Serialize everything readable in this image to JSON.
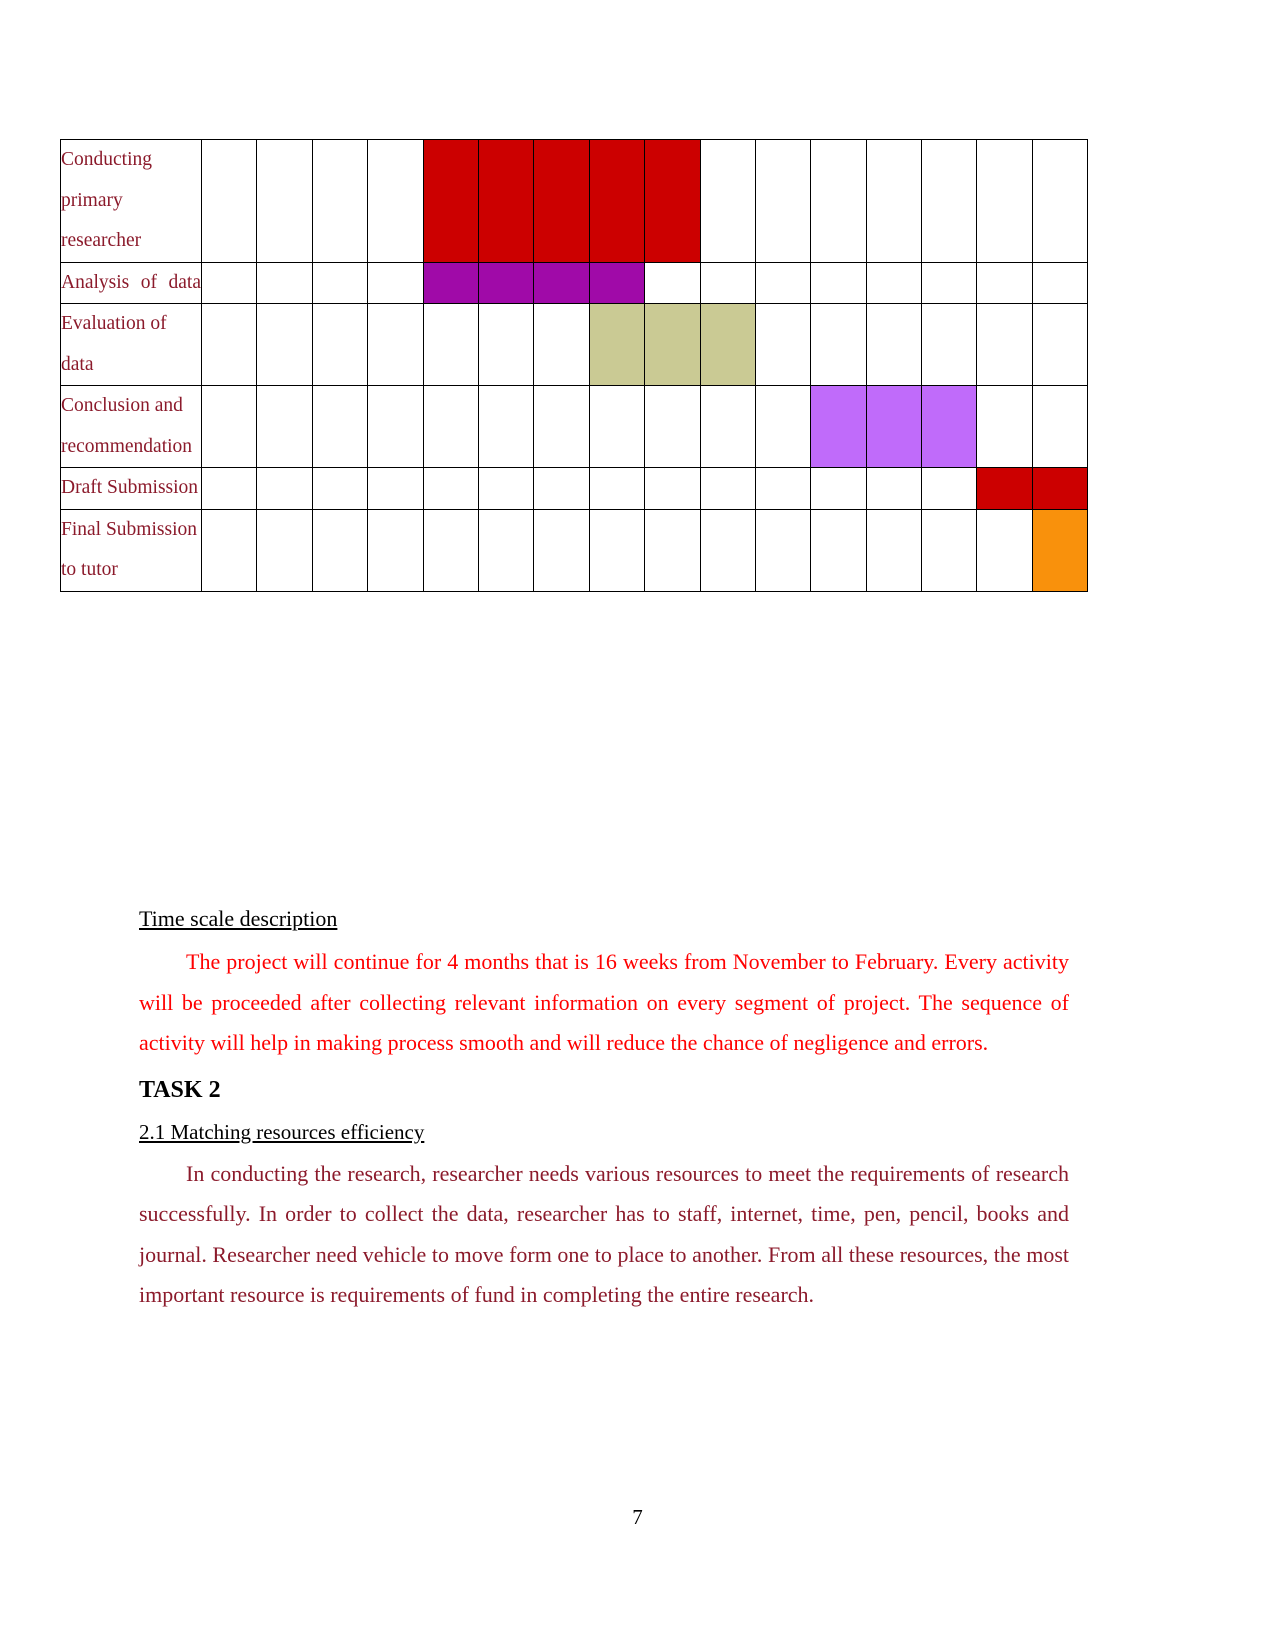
{
  "document": {
    "page_number": "7"
  },
  "gantt": {
    "columns": 16,
    "colors": {
      "red": "#CC0000",
      "purple": "#A00AA8",
      "khaki": "#CACA94",
      "orchid": "#C06BFA",
      "orange": "#F9910C"
    },
    "rows": [
      {
        "task": "Conducting primary researcher",
        "bar_start": 5,
        "bar_end": 9,
        "color_key": "red",
        "justify": false
      },
      {
        "task": "Analysis of data",
        "bar_start": 5,
        "bar_end": 8,
        "color_key": "purple",
        "justify": true
      },
      {
        "task": "Evaluation of data",
        "bar_start": 8,
        "bar_end": 10,
        "color_key": "khaki",
        "justify": false
      },
      {
        "task": "Conclusion and recommendation",
        "bar_start": 12,
        "bar_end": 14,
        "color_key": "orchid",
        "justify": false
      },
      {
        "task": "Draft Submission",
        "bar_start": 15,
        "bar_end": 16,
        "color_key": "red",
        "justify": false
      },
      {
        "task": "Final Submission to tutor",
        "bar_start": 16,
        "bar_end": 16,
        "color_key": "orange",
        "justify": false
      }
    ]
  },
  "sections": {
    "timescale_heading": "Time scale description",
    "timescale_paragraph": "The project will continue for 4 months that is 16 weeks from November to February. Every activity will be proceeded after collecting relevant information on every segment of project. The sequence of activity will help in making process smooth and will reduce the chance of negligence and errors.",
    "task_heading": "TASK 2",
    "subsection_heading": "2.1 Matching resources efficiency",
    "subsection_paragraph": "In conducting the research, researcher needs various resources to meet the requirements of research successfully. In order to collect the data, researcher has to staff, internet, time, pen, pencil, books and journal. Researcher need vehicle to move form one to place to another. From all these resources, the most important resource is requirements of fund in completing the entire research."
  }
}
